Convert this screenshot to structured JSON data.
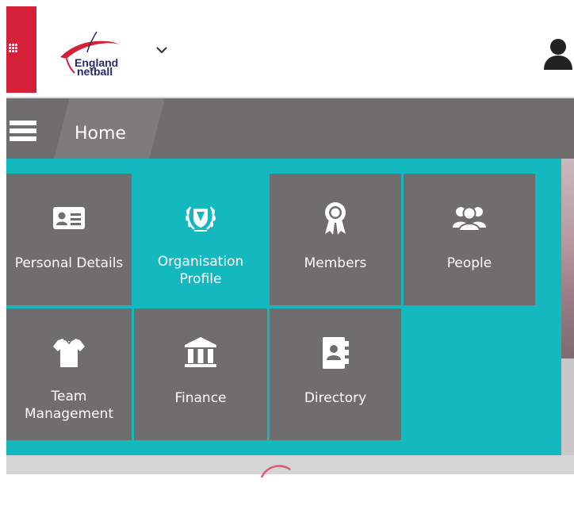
{
  "header": {
    "apps_icon": "grid-icon",
    "logo_text_line1": "England",
    "logo_text_line2": "netball",
    "dropdown_icon": "chevron-down-icon",
    "user_icon": "user-icon",
    "brand_red": "#d42038"
  },
  "nav": {
    "menu_icon": "hamburger-icon",
    "home_label": "Home"
  },
  "tiles": [
    {
      "label": "Personal Details",
      "icon": "id-card-icon",
      "active": false
    },
    {
      "label": "Organisation\nProfile",
      "icon": "laurel-shield-icon",
      "active": true
    },
    {
      "label": "Members",
      "icon": "rosette-icon",
      "active": false
    },
    {
      "label": "People",
      "icon": "people-icon",
      "active": false
    },
    {
      "label": "Team\nManagement",
      "icon": "shirt-icon",
      "active": false
    },
    {
      "label": "Finance",
      "icon": "bank-icon",
      "active": false
    },
    {
      "label": "Directory",
      "icon": "address-book-icon",
      "active": false
    }
  ],
  "colors": {
    "teal": "#13b9bf",
    "tile_grey": "#6f6d6e",
    "nav_grey": "#6f6d6e"
  }
}
